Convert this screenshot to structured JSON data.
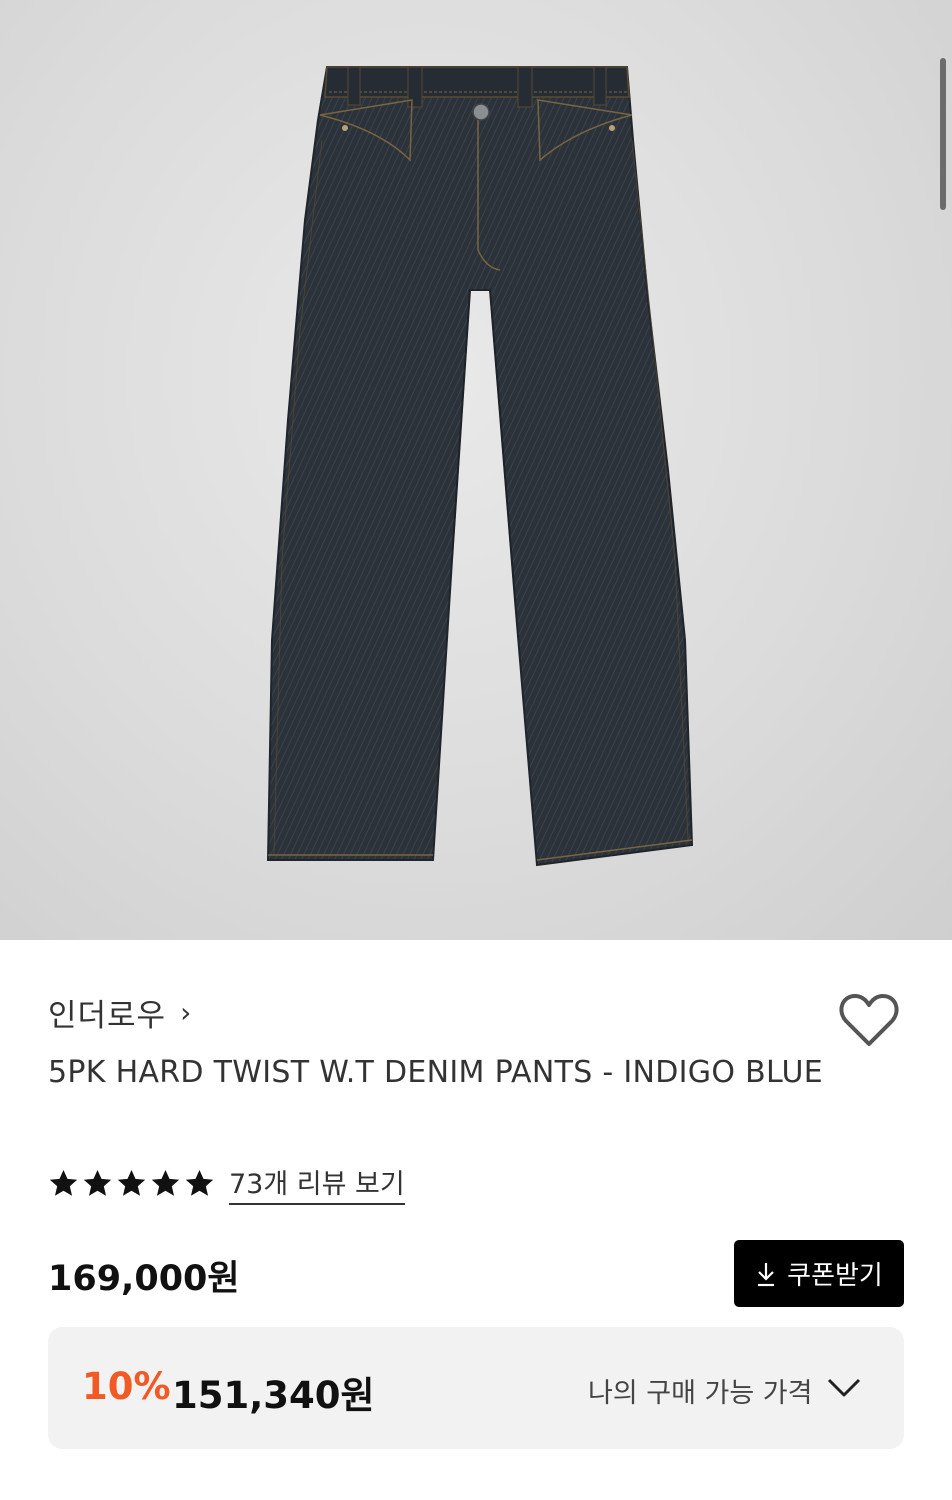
{
  "product": {
    "brand": "인더로우",
    "brand_chevron": "›",
    "title": "5PK HARD TWIST W.T DENIM PANTS - INDIGO BLUE",
    "rating_stars": 5,
    "review_link": "73개 리뷰 보기",
    "price": "169,000원",
    "coupon_button": "쿠폰받기",
    "discount": {
      "rate": "10%",
      "price": "151,340원",
      "my_price_label": "나의 구매 가능 가격"
    }
  },
  "icons": {
    "like": "heart-outline-icon",
    "coupon": "download-icon",
    "expand": "chevron-down-icon",
    "star": "star-filled-icon"
  },
  "colors": {
    "discount_accent": "#f15a24",
    "coupon_button_bg": "#000000",
    "price_box_bg": "#f2f2f2",
    "denim": "#2b323a"
  }
}
